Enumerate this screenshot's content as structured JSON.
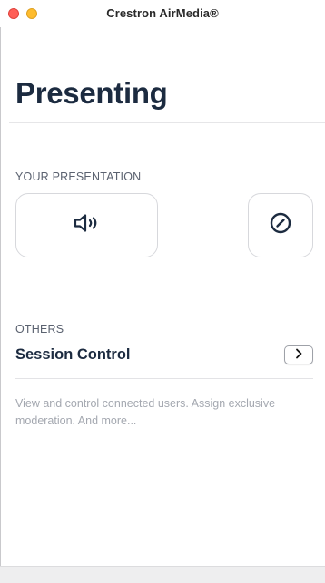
{
  "window": {
    "title": "Crestron AirMedia®"
  },
  "page": {
    "title": "Presenting"
  },
  "your_presentation": {
    "label": "YOUR PRESENTATION",
    "audio_button_icon": "speaker-icon",
    "stop_button_icon": "stop-circle-icon"
  },
  "others": {
    "label": "OTHERS",
    "session_control": {
      "title": "Session Control",
      "icon": "chevron-right-icon",
      "description": "View and control connected users. Assign exclusive moderation. And more..."
    }
  },
  "colors": {
    "title_text": "#1c2b40",
    "section_label": "#5b6270",
    "description_text": "#a4a8b0",
    "close_light": "#ff5f57",
    "minimize_light": "#febc2e"
  }
}
